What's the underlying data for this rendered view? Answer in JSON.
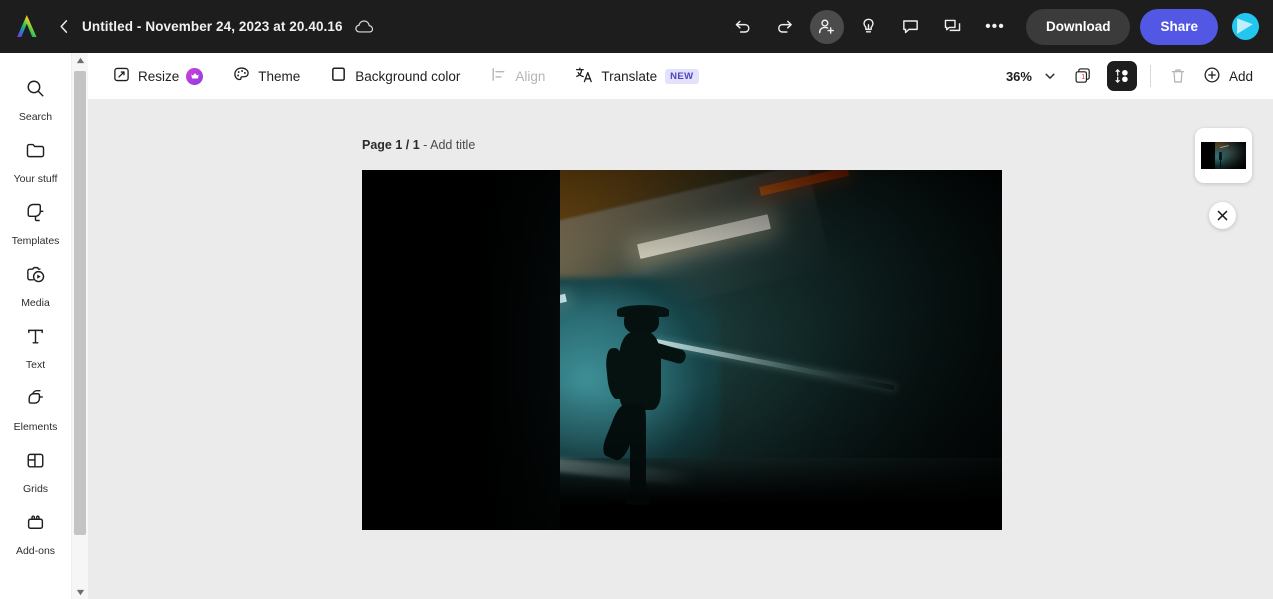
{
  "topbar": {
    "logo_icon": "adobe-express-logo",
    "back_icon": "chevron-left-icon",
    "doc_title": "Untitled - November 24, 2023 at 20.40.16",
    "cloud_icon": "cloud-saved-icon",
    "undo_icon": "undo-icon",
    "redo_icon": "redo-icon",
    "invite_icon": "add-person-icon",
    "ideas_icon": "lightbulb-icon",
    "comment_icon": "comment-icon",
    "duplicate_icon": "duplicate-chat-icon",
    "more_icon": "more-options-icon",
    "more_glyph": "•••",
    "download_label": "Download",
    "share_label": "Share",
    "avatar_label": "user-avatar",
    "share_color": "#5258e4",
    "download_color": "#3b3b3b",
    "bar_color": "#1d1d1d"
  },
  "subbar": {
    "tools": [
      {
        "id": "resize",
        "label": "Resize",
        "icon": "resize-icon",
        "disabled": false,
        "premium": true,
        "badge": ""
      },
      {
        "id": "theme",
        "label": "Theme",
        "icon": "palette-icon",
        "disabled": false,
        "premium": false,
        "badge": ""
      },
      {
        "id": "background-color",
        "label": "Background color",
        "icon": "background-circle-icon",
        "disabled": false,
        "premium": false,
        "badge": ""
      },
      {
        "id": "align",
        "label": "Align",
        "icon": "align-icon",
        "disabled": true,
        "premium": false,
        "badge": ""
      },
      {
        "id": "translate",
        "label": "Translate",
        "icon": "translate-icon",
        "disabled": false,
        "premium": false,
        "badge": "NEW"
      }
    ],
    "zoom_value": "36%",
    "zoom_caret_icon": "chevron-down-icon",
    "pages_icon": "page-stack-icon",
    "pages_count": "1",
    "layout_toggle_icon": "pages-panel-icon",
    "delete_icon": "trash-icon",
    "add_icon": "plus-circle-icon",
    "add_label": "Add",
    "new_badge_bg": "#e3e1fb",
    "new_badge_fg": "#4b45c7"
  },
  "rail": {
    "items": [
      {
        "id": "search",
        "label": "Search",
        "icon": "search-icon"
      },
      {
        "id": "yourstuff",
        "label": "Your stuff",
        "icon": "folder-icon"
      },
      {
        "id": "templates",
        "label": "Templates",
        "icon": "templates-icon"
      },
      {
        "id": "media",
        "label": "Media",
        "icon": "media-icon"
      },
      {
        "id": "text",
        "label": "Text",
        "icon": "text-icon"
      },
      {
        "id": "elements",
        "label": "Elements",
        "icon": "elements-icon"
      },
      {
        "id": "grids",
        "label": "Grids",
        "icon": "grids-icon"
      },
      {
        "id": "addons",
        "label": "Add-ons",
        "icon": "addons-icon"
      }
    ],
    "scroll_up_icon": "scroll-up-arrow-icon",
    "scroll_down_icon": "scroll-down-arrow-icon"
  },
  "canvas": {
    "page_label_bold": "Page 1 / 1",
    "page_label_rest": " - Add title",
    "background_color": "#ebebeb",
    "artboard_alt": "dark underpass photo with silhouetted runner",
    "thumbnail_alt": "page-1-thumbnail",
    "close_icon": "close-icon",
    "close_glyph": "✕"
  }
}
